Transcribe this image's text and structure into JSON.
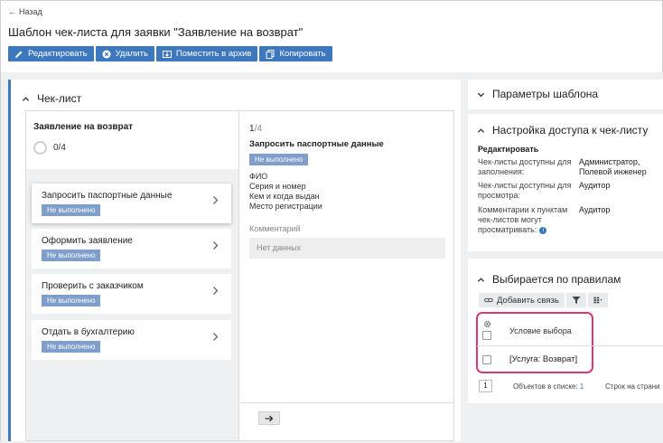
{
  "header": {
    "back_label": "Назад",
    "title": "Шаблон чек-листа для заявки \"Заявление на возврат\""
  },
  "toolbar": {
    "edit": "Редактировать",
    "delete": "Удалить",
    "archive": "Поместить в архив",
    "copy": "Копировать"
  },
  "checklist": {
    "heading": "Чек-лист",
    "name": "Заявление на возврат",
    "progress": "0/4",
    "items": [
      {
        "title": "Запросить паспортные данные",
        "status": "Не выполнено"
      },
      {
        "title": "Оформить заявление",
        "status": "Не выполнено"
      },
      {
        "title": "Проверить с заказчиком",
        "status": "Не выполнено"
      },
      {
        "title": "Отдать в бухгалтерию",
        "status": "Не выполнено"
      }
    ],
    "detail": {
      "step_current": "1",
      "step_total": "/4",
      "title": "Запросить паспортные данные",
      "status": "Не выполнено",
      "lines": [
        "ФИО",
        "Серия и номер",
        "Кем и когда выдан",
        "Место регистрации"
      ],
      "comment_label": "Комментарий",
      "comment_value": "Нет данных"
    }
  },
  "params": {
    "heading": "Параметры шаблона"
  },
  "access": {
    "heading": "Настройка доступа к чек-листу",
    "subheading": "Редактировать",
    "rows": [
      {
        "label": "Чек-листы доступны для заполнения:",
        "value": "Администратор, Полевой инженер"
      },
      {
        "label": "Чек-листы доступны для просмотра:",
        "value": "Аудитор"
      },
      {
        "label": "Комментарии к пунктам чек-листов могут просматривать:",
        "value": "Аудитор"
      }
    ]
  },
  "rules": {
    "heading": "Выбирается по правилам",
    "add_link": "Добавить связь",
    "column_header": "Условие выбора",
    "rows": [
      "[Услуга: Возврат]"
    ],
    "page": "1",
    "count_label": "Объектов в списке:",
    "count_value": "1",
    "rows_label": "Строк на страни"
  },
  "colors": {
    "accent": "#3d78bf",
    "badge": "#7e9fcc",
    "highlight": "#d8397a"
  }
}
